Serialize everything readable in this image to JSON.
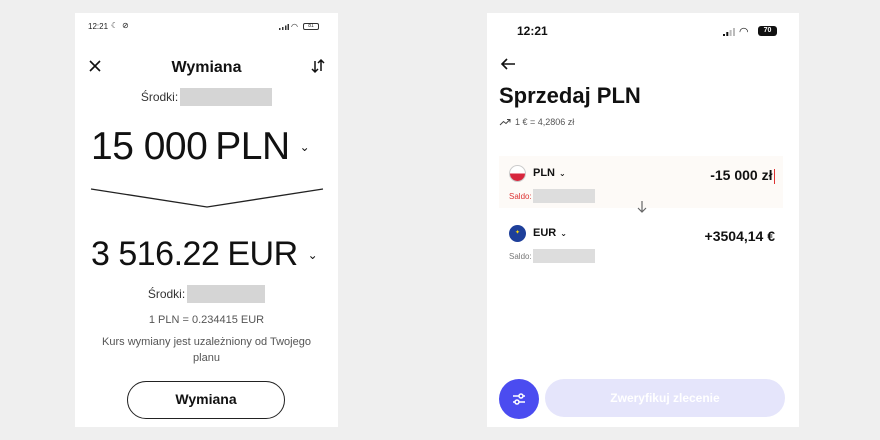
{
  "left": {
    "status": {
      "time": "12:21",
      "battery": "81"
    },
    "header": {
      "title": "Wymiana"
    },
    "from": {
      "funds_label": "Środki:",
      "amount": "15 000",
      "currency": "PLN"
    },
    "to": {
      "funds_label": "Środki:",
      "amount": "3 516.22",
      "currency": "EUR"
    },
    "rate": "1 PLN = 0.234415 EUR",
    "note": "Kurs wymiany jest uzależniony od Twojego planu",
    "button_label": "Wymiana"
  },
  "right": {
    "status": {
      "time": "12:21",
      "battery": "70"
    },
    "title": "Sprzedaj PLN",
    "rate": "1 € = 4,2806 zł",
    "from": {
      "code": "PLN",
      "saldo_label": "Saldo:",
      "value": "-15 000 zł"
    },
    "to": {
      "code": "EUR",
      "saldo_label": "Saldo:",
      "value": "+3504,14 €"
    },
    "verify_label": "Zweryfikuj zlecenie"
  },
  "icons": {
    "close": "close-icon",
    "swap": "swap-icon",
    "back": "back-arrow-icon",
    "trend": "trend-up-icon",
    "chevron": "chevron-down-icon",
    "filter": "sliders-icon"
  },
  "colors": {
    "accent": "#4b4cf0",
    "verify_disabled": "#e5e5fb",
    "error": "#d33333"
  }
}
